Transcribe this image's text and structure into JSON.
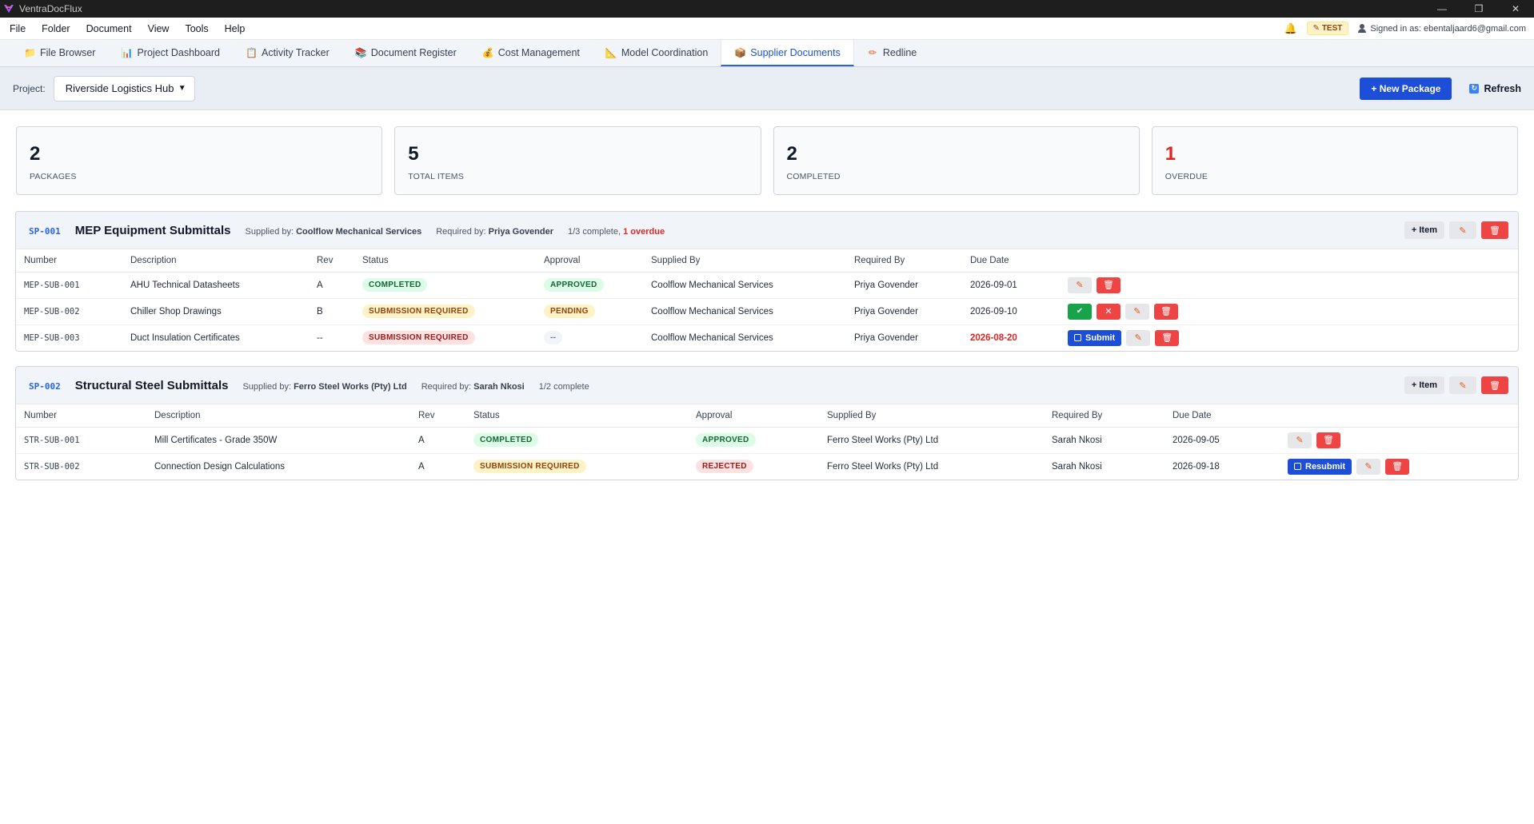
{
  "window": {
    "title": "VentraDocFlux",
    "controls": [
      "—",
      "❐",
      "✕"
    ]
  },
  "menu": {
    "items": [
      "File",
      "Folder",
      "Document",
      "View",
      "Tools",
      "Help"
    ]
  },
  "status": {
    "env_badge": "✎ TEST",
    "signed_in": "Signed in as: ebentaljaard6@gmail.com"
  },
  "tabs": [
    {
      "label": "File Browser",
      "icon": "folder-icon",
      "glyph": "📁"
    },
    {
      "label": "Project Dashboard",
      "icon": "chart-icon",
      "glyph": "📊"
    },
    {
      "label": "Activity Tracker",
      "icon": "clipboard-icon",
      "glyph": "📋"
    },
    {
      "label": "Document Register",
      "icon": "books-icon",
      "glyph": "📚"
    },
    {
      "label": "Cost Management",
      "icon": "money-bag-icon",
      "glyph": "💰"
    },
    {
      "label": "Model Coordination",
      "icon": "ruler-icon",
      "glyph": "📐"
    },
    {
      "label": "Supplier Documents",
      "icon": "package-icon",
      "glyph": "📦"
    },
    {
      "label": "Redline",
      "icon": "pencil-icon",
      "glyph": "✏"
    }
  ],
  "toolbar": {
    "project_label": "Project:",
    "project_value": "Riverside Logistics Hub",
    "new_package": "+ New Package",
    "refresh": "Refresh"
  },
  "stats": [
    {
      "value": "2",
      "label": "PACKAGES"
    },
    {
      "value": "5",
      "label": "TOTAL ITEMS"
    },
    {
      "value": "2",
      "label": "COMPLETED"
    },
    {
      "value": "1",
      "label": "OVERDUE"
    }
  ],
  "packages": [
    {
      "code": "SP-001",
      "title": "MEP Equipment Submittals",
      "supplied_label": "Supplied by:",
      "supplied_by": "Coolflow Mechanical Services",
      "required_label": "Required by:",
      "required_by": "Priya Govender",
      "progress": "1/3 complete,",
      "overdue": "1 overdue",
      "add_item": "+ Item",
      "columns": [
        "Number",
        "Description",
        "Rev",
        "Status",
        "Approval",
        "Supplied By",
        "Required By",
        "Due Date",
        ""
      ],
      "rows": [
        {
          "number": "MEP-SUB-001",
          "description": "AHU Technical Datasheets",
          "rev": "A",
          "status": "COMPLETED",
          "approval": "APPROVED",
          "supplied_by": "Coolflow Mechanical Services",
          "required_by": "Priya Govender",
          "due": "2026-09-01"
        },
        {
          "number": "MEP-SUB-002",
          "description": "Chiller Shop Drawings",
          "rev": "B",
          "status": "SUBMISSION REQUIRED",
          "approval": "PENDING",
          "supplied_by": "Coolflow Mechanical Services",
          "required_by": "Priya Govender",
          "due": "2026-09-10"
        },
        {
          "number": "MEP-SUB-003",
          "description": "Duct Insulation Certificates",
          "rev": "--",
          "status": "SUBMISSION REQUIRED",
          "approval": "--",
          "supplied_by": "Coolflow Mechanical Services",
          "required_by": "Priya Govender",
          "due": "2026-08-20",
          "submit": "Submit"
        }
      ]
    },
    {
      "code": "SP-002",
      "title": "Structural Steel Submittals",
      "supplied_label": "Supplied by:",
      "supplied_by": "Ferro Steel Works (Pty) Ltd",
      "required_label": "Required by:",
      "required_by": "Sarah Nkosi",
      "progress": "1/2 complete",
      "add_item": "+ Item",
      "columns": [
        "Number",
        "Description",
        "Rev",
        "Status",
        "Approval",
        "Supplied By",
        "Required By",
        "Due Date",
        ""
      ],
      "rows": [
        {
          "number": "STR-SUB-001",
          "description": "Mill Certificates - Grade 350W",
          "rev": "A",
          "status": "COMPLETED",
          "approval": "APPROVED",
          "supplied_by": "Ferro Steel Works (Pty) Ltd",
          "required_by": "Sarah Nkosi",
          "due": "2026-09-05"
        },
        {
          "number": "STR-SUB-002",
          "description": "Connection Design Calculations",
          "rev": "A",
          "status": "SUBMISSION REQUIRED",
          "approval": "REJECTED",
          "supplied_by": "Ferro Steel Works (Pty) Ltd",
          "required_by": "Sarah Nkosi",
          "due": "2026-09-18",
          "resubmit": "Resubmit"
        }
      ]
    }
  ],
  "icons": {
    "edit": "✎",
    "delete": "🗑",
    "approve": "✔",
    "reject": "✕"
  },
  "colors": {
    "accent": "#1d4ed8",
    "danger": "#ef4444",
    "success": "#16a34a"
  }
}
